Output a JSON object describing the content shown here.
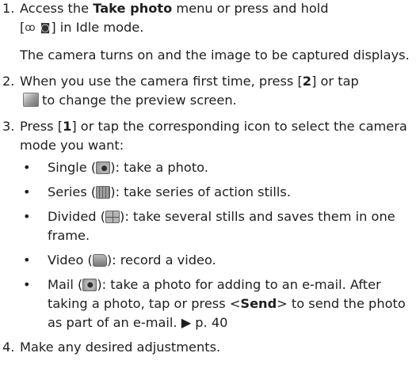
{
  "steps": [
    {
      "num": "1.",
      "line1_pre": "Access the ",
      "line1_bold": "Take photo",
      "line1_post": " menu or press and hold",
      "line2_open": "[",
      "line2_key_glyph": "ꝏ ◙",
      "line2_close": "] in Idle mode.",
      "para": "The camera turns on and the image to be captured displays."
    },
    {
      "num": "2.",
      "pre": "When you use the camera first time, press [",
      "key": "2",
      "mid": "] or tap",
      "post": "to change the preview screen.",
      "icon": "preview-toggle-icon"
    },
    {
      "num": "3.",
      "pre": "Press [",
      "key": "1",
      "post": "] or tap the corresponding icon to select the camera mode you want:",
      "modes": [
        {
          "bullet": "•",
          "name": "Single (",
          "close": "): take a photo.",
          "icon": "single-shot-icon"
        },
        {
          "bullet": "•",
          "name": "Series (",
          "close": "): take series of action stills.",
          "icon": "series-shot-icon"
        },
        {
          "bullet": "•",
          "name": "Divided (",
          "close": "): take several stills and saves them in one frame.",
          "icon": "divided-shot-icon"
        },
        {
          "bullet": "•",
          "name": "Video (",
          "close": "): record a video.",
          "icon": "video-icon"
        },
        {
          "bullet": "•",
          "name": "Mail (",
          "close": "): take a photo for adding to an e-mail. After taking a photo, tap or press",
          "send_open": "<",
          "send_bold": "Send",
          "send_close": "> to send the photo as part of an e-mail. ▶ p. 40",
          "icon": "mail-shot-icon"
        }
      ]
    },
    {
      "num": "4.",
      "text": "Make any desired adjustments."
    }
  ]
}
